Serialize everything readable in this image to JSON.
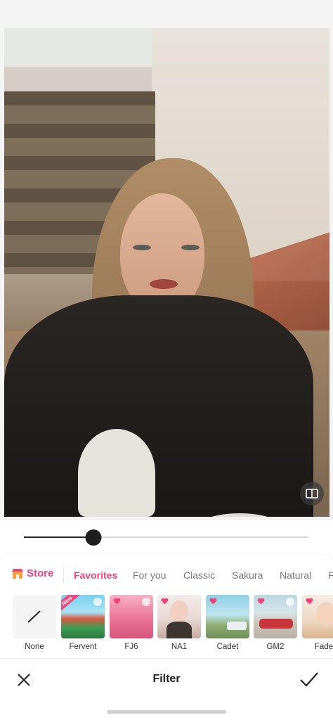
{
  "editor": {
    "compare_icon": "compare-split-icon",
    "intensity": 0.245
  },
  "categories": {
    "store_label": "Store",
    "store_icon": "store-icon",
    "tabs": [
      "Favorites",
      "For you",
      "Classic",
      "Sakura",
      "Natural",
      "F"
    ],
    "active_tab": "Favorites"
  },
  "filters": [
    {
      "name": "None"
    },
    {
      "name": "Fervent",
      "new_badge": "New"
    },
    {
      "name": "FJ6"
    },
    {
      "name": "NA1"
    },
    {
      "name": "Cadet"
    },
    {
      "name": "GM2"
    },
    {
      "name": "Fade"
    }
  ],
  "bottom_bar": {
    "title": "Filter",
    "close_icon": "close-icon",
    "confirm_icon": "check-icon"
  },
  "colors": {
    "accent": "#f0447b",
    "slider_fill": "#2a2a2a"
  }
}
